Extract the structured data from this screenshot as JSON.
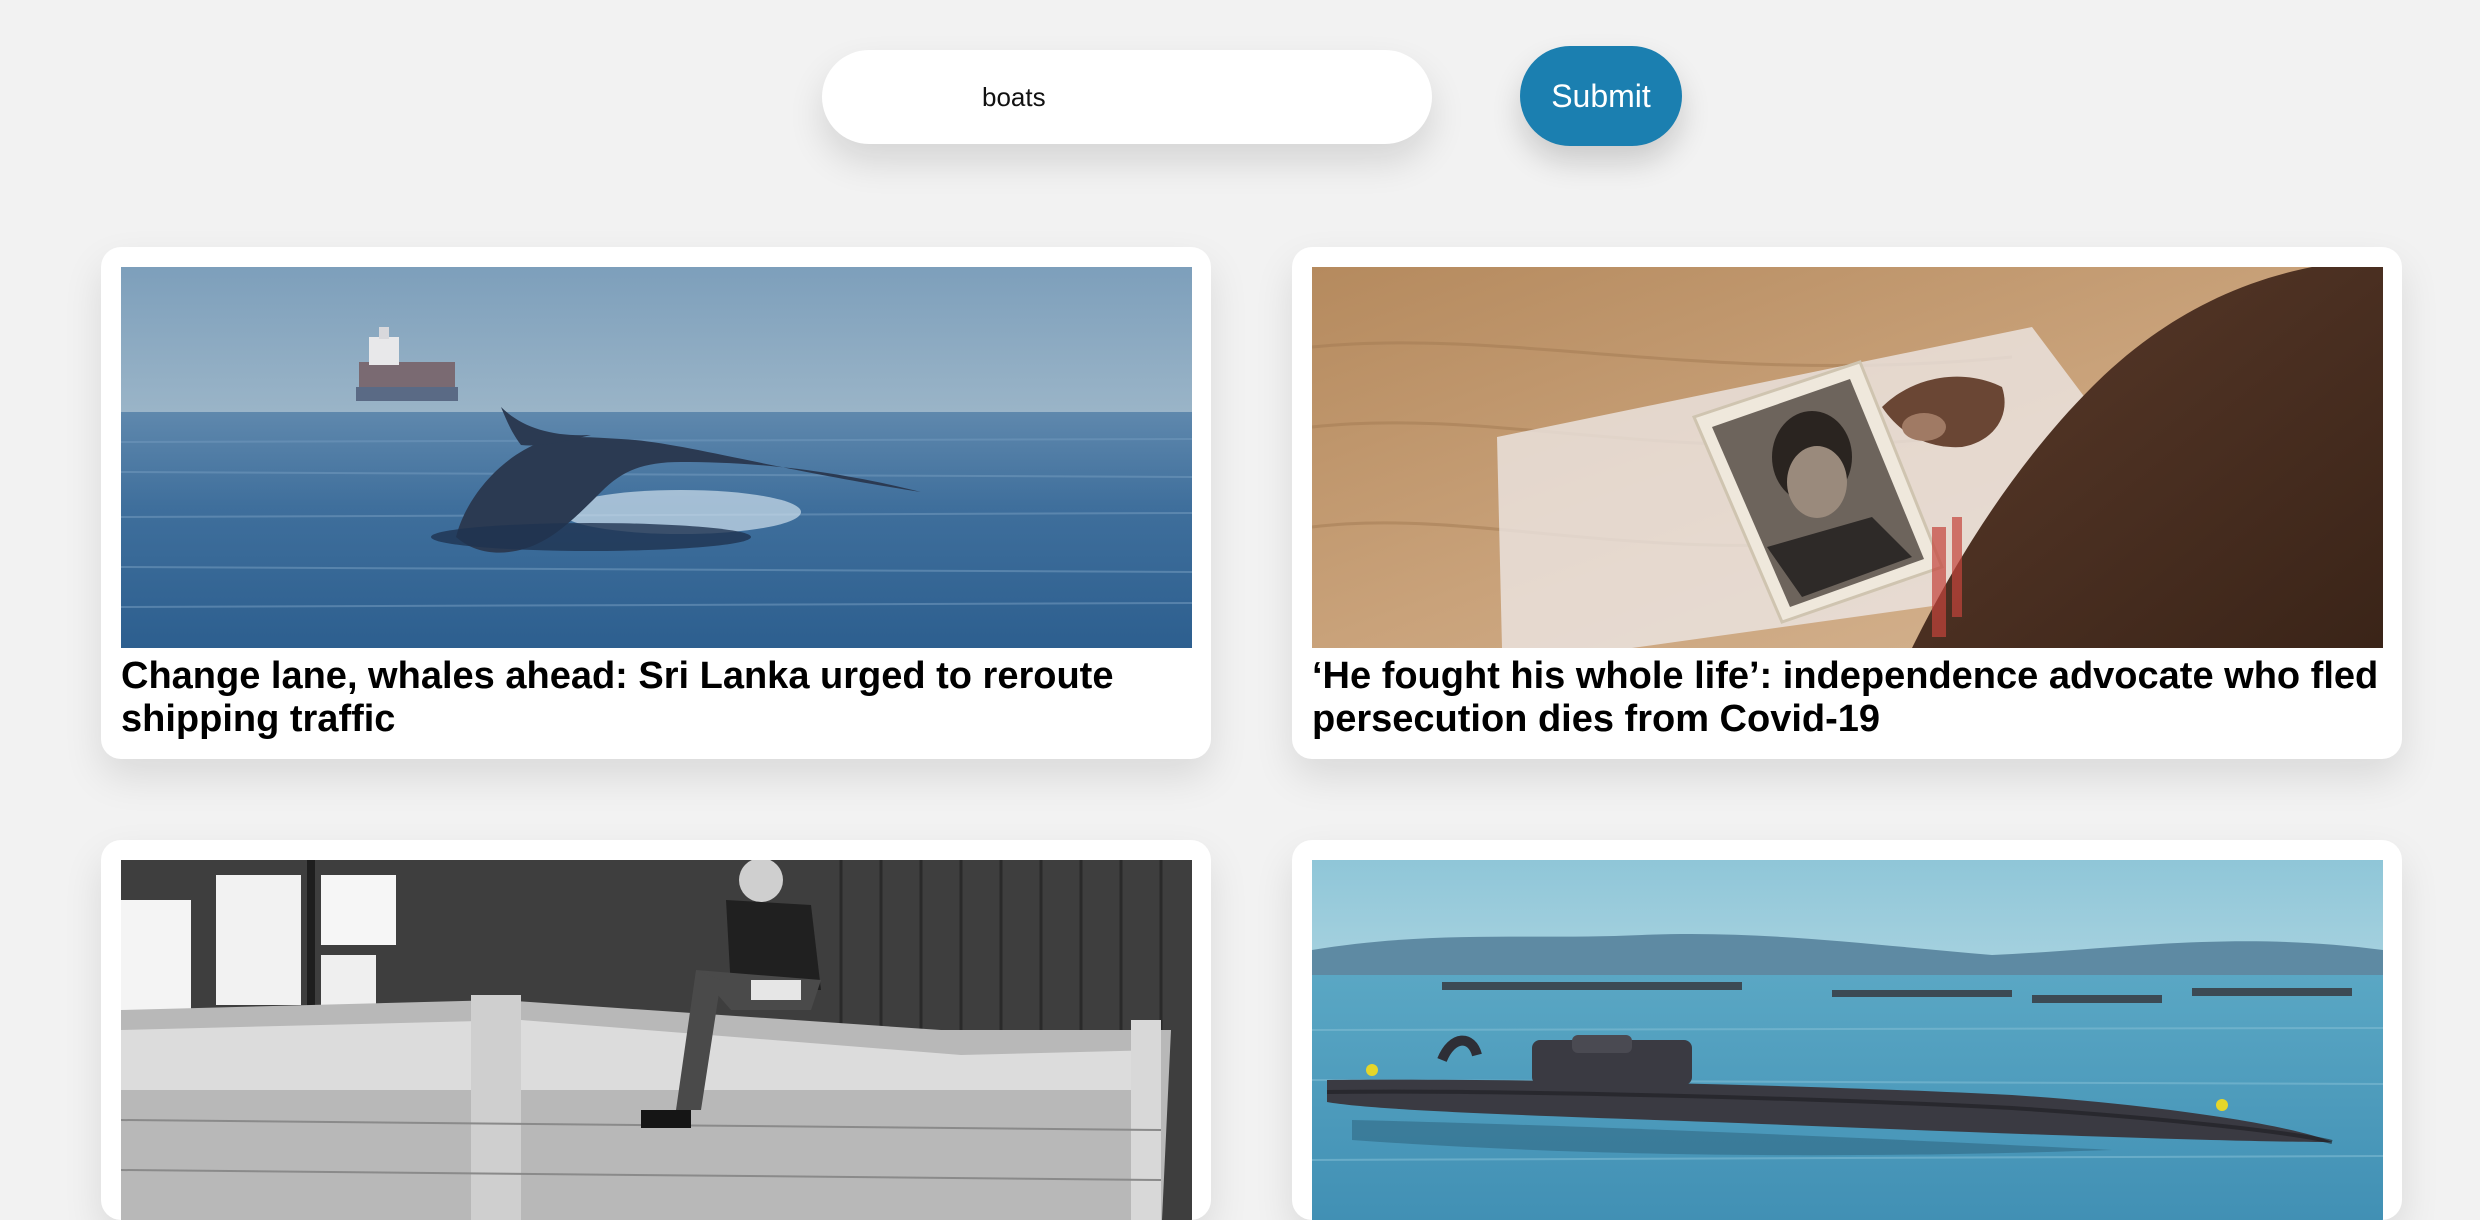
{
  "search": {
    "value": "boats",
    "submit_label": "Submit"
  },
  "colors": {
    "background": "#f2f2f2",
    "submit_button": "#1b7fb0"
  },
  "articles": [
    {
      "title": "Change lane, whales ahead: Sri Lanka urged to reroute shipping traffic",
      "image": "whale tail diving near cargo ship"
    },
    {
      "title": "‘He fought his whole life’: independence advocate who fled persecution dies from Covid-19",
      "image": "hand holding old portrait photograph"
    },
    {
      "title": "",
      "image": "black-and-white photo of man sitting on wooden boat in workshop"
    },
    {
      "title": "",
      "image": "semi-submerged narco submarine in harbour"
    }
  ]
}
